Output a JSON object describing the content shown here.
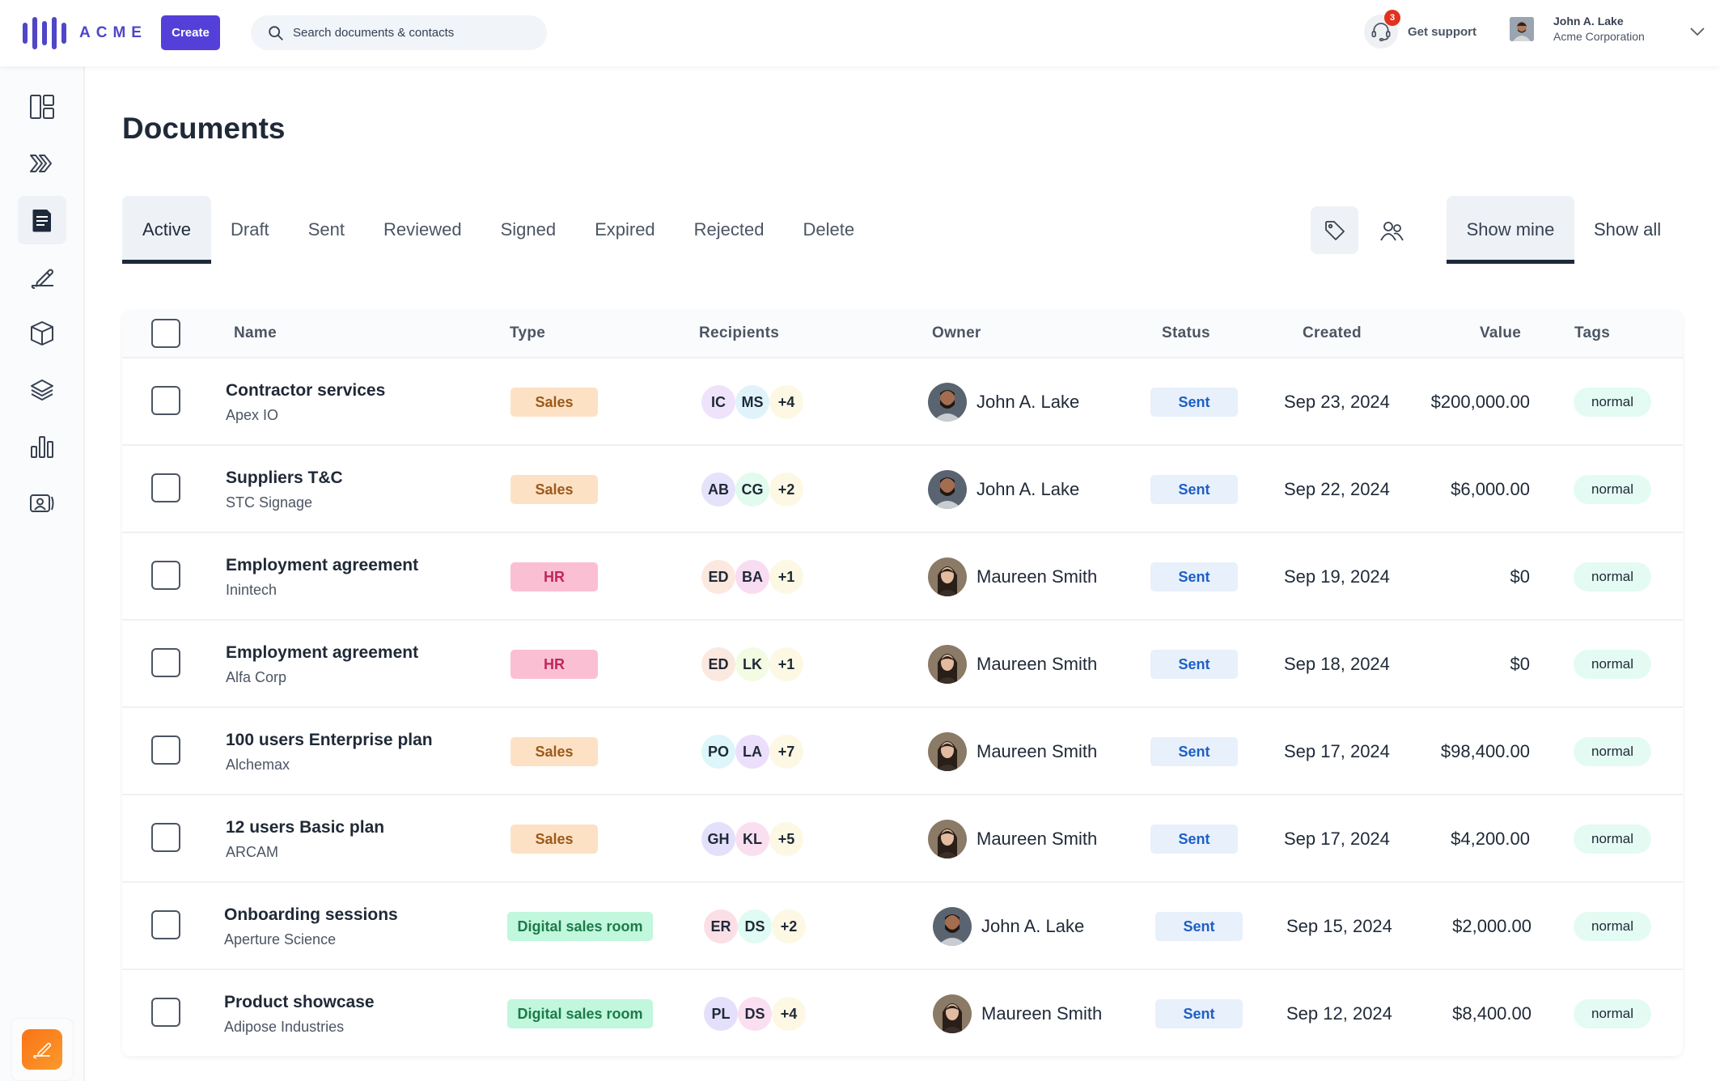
{
  "app": {
    "logo_text": "ACME",
    "create_label": "Create",
    "search_placeholder": "Search documents & contacts",
    "support": {
      "label": "Get support",
      "badge_count": "3"
    },
    "user": {
      "name": "John A. Lake",
      "organization": "Acme Corporation"
    }
  },
  "sidebar": {
    "items": [
      {
        "name": "dashboard",
        "icon": "layout-icon"
      },
      {
        "name": "pipeline",
        "icon": "chevrons-right-icon"
      },
      {
        "name": "documents",
        "icon": "document-icon",
        "active": true
      },
      {
        "name": "signatures",
        "icon": "pen-icon"
      },
      {
        "name": "products",
        "icon": "box-icon"
      },
      {
        "name": "templates",
        "icon": "layers-icon"
      },
      {
        "name": "reports",
        "icon": "bar-chart-icon"
      },
      {
        "name": "contacts",
        "icon": "contact-card-icon"
      }
    ],
    "bottom_action_icon": "sign-pen-icon"
  },
  "page": {
    "title": "Documents",
    "tabs": [
      "Active",
      "Draft",
      "Sent",
      "Reviewed",
      "Signed",
      "Expired",
      "Rejected",
      "Delete"
    ],
    "active_tab": "Active",
    "view_tabs": [
      "Show mine",
      "Show all"
    ],
    "active_view": "Show mine"
  },
  "table": {
    "columns": [
      "Name",
      "Type",
      "Recipients",
      "Owner",
      "Status",
      "Created",
      "Value",
      "Tags"
    ],
    "rows": [
      {
        "name": "Contractor services",
        "company": "Apex IO",
        "type": "Sales",
        "recipients": [
          {
            "initials": "IC",
            "color": "#efe3fb"
          },
          {
            "initials": "MS",
            "color": "#e0f3fb"
          },
          {
            "initials": "+4",
            "color": "#fcf8e3"
          }
        ],
        "owner": "John A. Lake",
        "status": "Sent",
        "created": "Sep 23, 2024",
        "value": "$200,000.00",
        "tag": "normal"
      },
      {
        "name": "Suppliers T&C",
        "company": "STC Signage",
        "type": "Sales",
        "recipients": [
          {
            "initials": "AB",
            "color": "#e5e2fb"
          },
          {
            "initials": "CG",
            "color": "#e1fbee"
          },
          {
            "initials": "+2",
            "color": "#fcf8e3"
          }
        ],
        "owner": "John A. Lake",
        "status": "Sent",
        "created": "Sep 22, 2024",
        "value": "$6,000.00",
        "tag": "normal"
      },
      {
        "name": "Employment agreement",
        "company": "Inintech",
        "type": "HR",
        "recipients": [
          {
            "initials": "ED",
            "color": "#fbe8df"
          },
          {
            "initials": "BA",
            "color": "#f8dcf2"
          },
          {
            "initials": "+1",
            "color": "#fcf8e3"
          }
        ],
        "owner": "Maureen Smith",
        "status": "Sent",
        "created": "Sep 19, 2024",
        "value": "$0",
        "tag": "normal"
      },
      {
        "name": "Employment agreement",
        "company": "Alfa Corp",
        "type": "HR",
        "recipients": [
          {
            "initials": "ED",
            "color": "#fbe8df"
          },
          {
            "initials": "LK",
            "color": "#f3fbe3"
          },
          {
            "initials": "+1",
            "color": "#fcf8e3"
          }
        ],
        "owner": "Maureen Smith",
        "status": "Sent",
        "created": "Sep 18, 2024",
        "value": "$0",
        "tag": "normal"
      },
      {
        "name": "100 users Enterprise plan",
        "company": "Alchemax",
        "type": "Sales",
        "recipients": [
          {
            "initials": "PO",
            "color": "#dcf6fa"
          },
          {
            "initials": "LA",
            "color": "#ebdffb"
          },
          {
            "initials": "+7",
            "color": "#fcf8e3"
          }
        ],
        "owner": "Maureen Smith",
        "status": "Sent",
        "created": "Sep 17, 2024",
        "value": "$98,400.00",
        "tag": "normal"
      },
      {
        "name": "12 users Basic plan",
        "company": "ARCAM",
        "type": "Sales",
        "recipients": [
          {
            "initials": "GH",
            "color": "#e2e0fb"
          },
          {
            "initials": "KL",
            "color": "#fadff0"
          },
          {
            "initials": "+5",
            "color": "#fcf8e3"
          }
        ],
        "owner": "Maureen Smith",
        "status": "Sent",
        "created": "Sep 17, 2024",
        "value": "$4,200.00",
        "tag": "normal"
      },
      {
        "name": "Onboarding sessions",
        "company": "Aperture Science",
        "type": "Digital sales room",
        "recipients": [
          {
            "initials": "ER",
            "color": "#fbdfe6"
          },
          {
            "initials": "DS",
            "color": "#dffbf3"
          },
          {
            "initials": "+2",
            "color": "#fcf8e3"
          }
        ],
        "owner": "John A. Lake",
        "status": "Sent",
        "created": "Sep 15, 2024",
        "value": "$2,000.00",
        "tag": "normal"
      },
      {
        "name": "Product showcase",
        "company": "Adipose Industries",
        "type": "Digital sales room",
        "recipients": [
          {
            "initials": "PL",
            "color": "#e4e0fb"
          },
          {
            "initials": "DS",
            "color": "#fadff0"
          },
          {
            "initials": "+4",
            "color": "#fcf8e3"
          }
        ],
        "owner": "Maureen Smith",
        "status": "Sent",
        "created": "Sep 12, 2024",
        "value": "$8,400.00",
        "tag": "normal"
      }
    ]
  },
  "colors": {
    "brand": "#5440d9",
    "type_badges": {
      "Sales": {
        "bg": "#fde1c4",
        "fg": "#9a5a1c"
      },
      "HR": {
        "bg": "#fbbfd4",
        "fg": "#c0265a"
      },
      "Digital sales room": {
        "bg": "#c1f7dc",
        "fg": "#1d7a4a"
      }
    },
    "status_sent": "#1d5fc4",
    "tag_bg": "#e4fbf3"
  }
}
